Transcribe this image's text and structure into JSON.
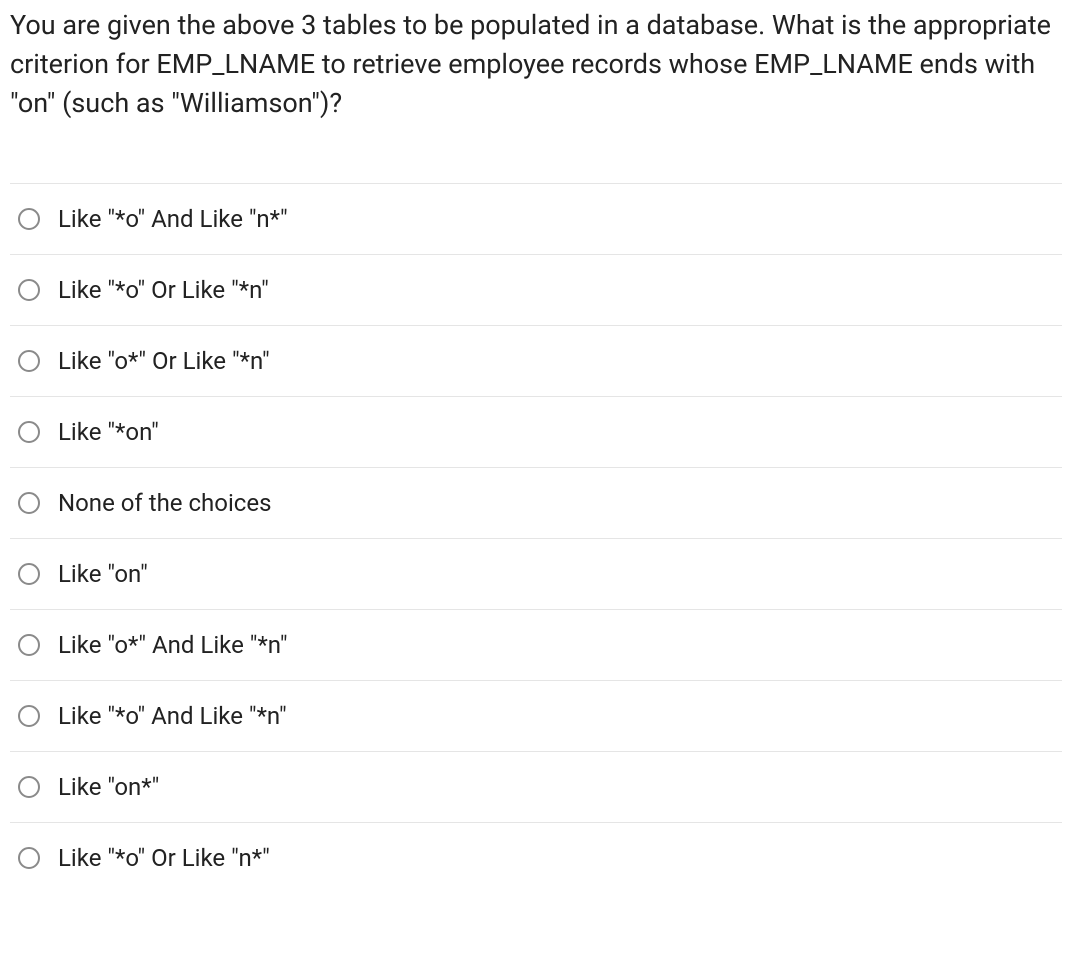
{
  "question": {
    "text": "You are given the above 3 tables to be populated in a database. What is the appropriate criterion for EMP_LNAME to retrieve employee records whose EMP_LNAME ends with \"on\" (such as \"Williamson\")?"
  },
  "options": [
    {
      "label": "Like \"*o\" And Like \"n*\""
    },
    {
      "label": "Like \"*o\" Or Like \"*n\""
    },
    {
      "label": "Like \"o*\" Or Like \"*n\""
    },
    {
      "label": "Like \"*on\""
    },
    {
      "label": "None of the choices"
    },
    {
      "label": "Like \"on\""
    },
    {
      "label": "Like \"o*\" And Like \"*n\""
    },
    {
      "label": "Like \"*o\" And Like \"*n\""
    },
    {
      "label": "Like \"on*\""
    },
    {
      "label": "Like \"*o\" Or Like \"n*\""
    }
  ]
}
